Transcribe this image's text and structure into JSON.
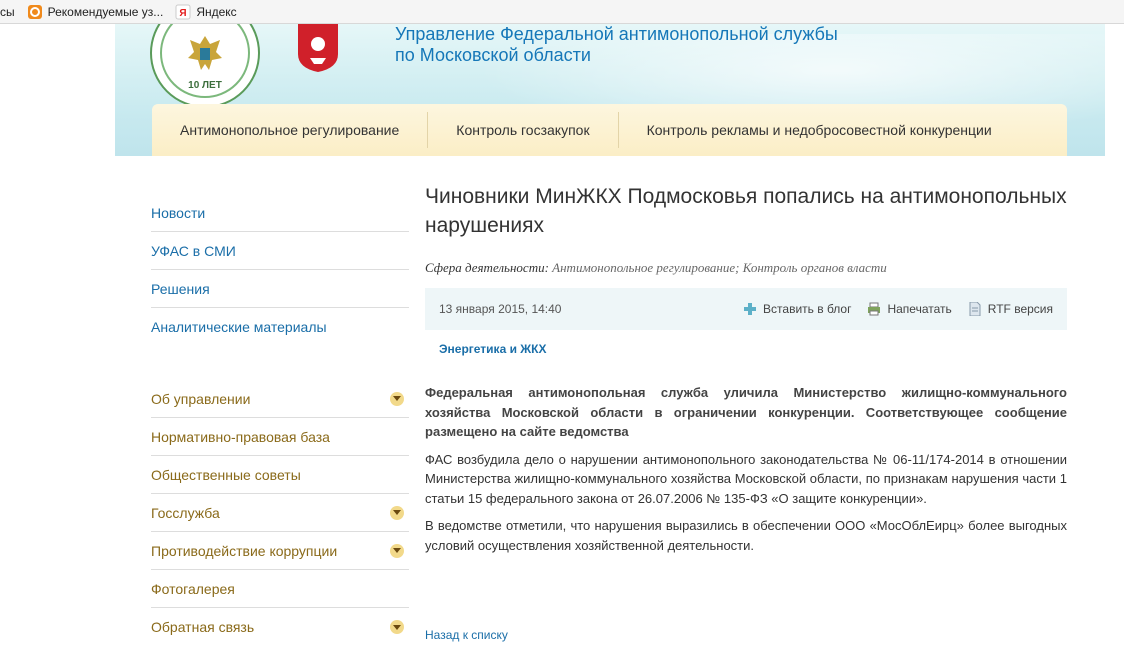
{
  "bookmarks": [
    {
      "label": "сы",
      "icon": "none"
    },
    {
      "label": "Рекомендуемые уз...",
      "icon": "bookmark-b-icon"
    },
    {
      "label": "Яндекс",
      "icon": "yandex-icon"
    }
  ],
  "header": {
    "title_line1": "Управление Федеральной антимонопольной службы",
    "title_line2": "по Московской области",
    "emblem_years": "10 ЛЕТ"
  },
  "topnav": [
    "Антимонопольное регулирование",
    "Контроль госзакупок",
    "Контроль рекламы и недобросовестной конкуренции"
  ],
  "sidebar": {
    "links": [
      "Новости",
      "УФАС в СМИ",
      "Решения",
      "Аналитические материалы"
    ],
    "groups": [
      {
        "label": "Об управлении",
        "expandable": true
      },
      {
        "label": "Нормативно-правовая база",
        "expandable": false
      },
      {
        "label": "Общественные советы",
        "expandable": false
      },
      {
        "label": "Госслужба",
        "expandable": true
      },
      {
        "label": "Противодействие коррупции",
        "expandable": true
      },
      {
        "label": "Фотогалерея",
        "expandable": false
      },
      {
        "label": "Обратная связь",
        "expandable": true
      }
    ]
  },
  "article": {
    "headline": "Чиновники МинЖКХ Подмосковья попались на антимонопольных нарушениях",
    "sphere_label": "Сфера деятельности:",
    "sphere_value": "Антимонопольное регулирование; Контроль органов власти",
    "date": "13 января 2015, 14:40",
    "tools": {
      "blog": "Вставить в блог",
      "print": "Напечатать",
      "rtf": "RTF версия"
    },
    "tag": "Энергетика и ЖКХ",
    "lead": "Федеральная антимонопольная служба уличила Министерство жилищно-коммунального хозяйства Московской области в ограничении конкуренции. Соответствующее сообщение размещено на сайте ведомства",
    "para1": "ФАС возбудила дело о нарушении антимонопольного законодательства № 06-11/174-2014 в отношении Министерства жилищно-коммунального хозяйства Московской области, по признакам нарушения части 1 статьи 15 федерального закона от 26.07.2006 № 135-ФЗ «О защите конкуренции».",
    "para2": "В ведомстве отметили, что нарушения выразились в обеспечении ООО «МосОблЕирц» более выгодных условий осуществления хозяйственной деятельности.",
    "back": "Назад к списку"
  },
  "colors": {
    "link": "#1a6ea8",
    "sidebar_group": "#8a6a1a",
    "title": "#1577b8",
    "nav_bg": "#fbeec6"
  }
}
